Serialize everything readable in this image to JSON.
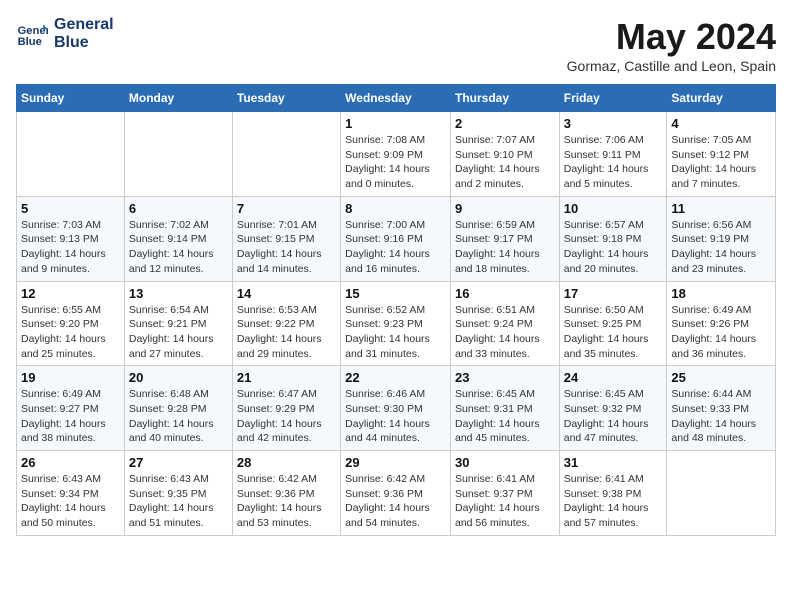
{
  "header": {
    "logo_line1": "General",
    "logo_line2": "Blue",
    "month_title": "May 2024",
    "location": "Gormaz, Castille and Leon, Spain"
  },
  "weekdays": [
    "Sunday",
    "Monday",
    "Tuesday",
    "Wednesday",
    "Thursday",
    "Friday",
    "Saturday"
  ],
  "weeks": [
    [
      {
        "day": "",
        "sunrise": "",
        "sunset": "",
        "daylight": ""
      },
      {
        "day": "",
        "sunrise": "",
        "sunset": "",
        "daylight": ""
      },
      {
        "day": "",
        "sunrise": "",
        "sunset": "",
        "daylight": ""
      },
      {
        "day": "1",
        "sunrise": "Sunrise: 7:08 AM",
        "sunset": "Sunset: 9:09 PM",
        "daylight": "Daylight: 14 hours and 0 minutes."
      },
      {
        "day": "2",
        "sunrise": "Sunrise: 7:07 AM",
        "sunset": "Sunset: 9:10 PM",
        "daylight": "Daylight: 14 hours and 2 minutes."
      },
      {
        "day": "3",
        "sunrise": "Sunrise: 7:06 AM",
        "sunset": "Sunset: 9:11 PM",
        "daylight": "Daylight: 14 hours and 5 minutes."
      },
      {
        "day": "4",
        "sunrise": "Sunrise: 7:05 AM",
        "sunset": "Sunset: 9:12 PM",
        "daylight": "Daylight: 14 hours and 7 minutes."
      }
    ],
    [
      {
        "day": "5",
        "sunrise": "Sunrise: 7:03 AM",
        "sunset": "Sunset: 9:13 PM",
        "daylight": "Daylight: 14 hours and 9 minutes."
      },
      {
        "day": "6",
        "sunrise": "Sunrise: 7:02 AM",
        "sunset": "Sunset: 9:14 PM",
        "daylight": "Daylight: 14 hours and 12 minutes."
      },
      {
        "day": "7",
        "sunrise": "Sunrise: 7:01 AM",
        "sunset": "Sunset: 9:15 PM",
        "daylight": "Daylight: 14 hours and 14 minutes."
      },
      {
        "day": "8",
        "sunrise": "Sunrise: 7:00 AM",
        "sunset": "Sunset: 9:16 PM",
        "daylight": "Daylight: 14 hours and 16 minutes."
      },
      {
        "day": "9",
        "sunrise": "Sunrise: 6:59 AM",
        "sunset": "Sunset: 9:17 PM",
        "daylight": "Daylight: 14 hours and 18 minutes."
      },
      {
        "day": "10",
        "sunrise": "Sunrise: 6:57 AM",
        "sunset": "Sunset: 9:18 PM",
        "daylight": "Daylight: 14 hours and 20 minutes."
      },
      {
        "day": "11",
        "sunrise": "Sunrise: 6:56 AM",
        "sunset": "Sunset: 9:19 PM",
        "daylight": "Daylight: 14 hours and 23 minutes."
      }
    ],
    [
      {
        "day": "12",
        "sunrise": "Sunrise: 6:55 AM",
        "sunset": "Sunset: 9:20 PM",
        "daylight": "Daylight: 14 hours and 25 minutes."
      },
      {
        "day": "13",
        "sunrise": "Sunrise: 6:54 AM",
        "sunset": "Sunset: 9:21 PM",
        "daylight": "Daylight: 14 hours and 27 minutes."
      },
      {
        "day": "14",
        "sunrise": "Sunrise: 6:53 AM",
        "sunset": "Sunset: 9:22 PM",
        "daylight": "Daylight: 14 hours and 29 minutes."
      },
      {
        "day": "15",
        "sunrise": "Sunrise: 6:52 AM",
        "sunset": "Sunset: 9:23 PM",
        "daylight": "Daylight: 14 hours and 31 minutes."
      },
      {
        "day": "16",
        "sunrise": "Sunrise: 6:51 AM",
        "sunset": "Sunset: 9:24 PM",
        "daylight": "Daylight: 14 hours and 33 minutes."
      },
      {
        "day": "17",
        "sunrise": "Sunrise: 6:50 AM",
        "sunset": "Sunset: 9:25 PM",
        "daylight": "Daylight: 14 hours and 35 minutes."
      },
      {
        "day": "18",
        "sunrise": "Sunrise: 6:49 AM",
        "sunset": "Sunset: 9:26 PM",
        "daylight": "Daylight: 14 hours and 36 minutes."
      }
    ],
    [
      {
        "day": "19",
        "sunrise": "Sunrise: 6:49 AM",
        "sunset": "Sunset: 9:27 PM",
        "daylight": "Daylight: 14 hours and 38 minutes."
      },
      {
        "day": "20",
        "sunrise": "Sunrise: 6:48 AM",
        "sunset": "Sunset: 9:28 PM",
        "daylight": "Daylight: 14 hours and 40 minutes."
      },
      {
        "day": "21",
        "sunrise": "Sunrise: 6:47 AM",
        "sunset": "Sunset: 9:29 PM",
        "daylight": "Daylight: 14 hours and 42 minutes."
      },
      {
        "day": "22",
        "sunrise": "Sunrise: 6:46 AM",
        "sunset": "Sunset: 9:30 PM",
        "daylight": "Daylight: 14 hours and 44 minutes."
      },
      {
        "day": "23",
        "sunrise": "Sunrise: 6:45 AM",
        "sunset": "Sunset: 9:31 PM",
        "daylight": "Daylight: 14 hours and 45 minutes."
      },
      {
        "day": "24",
        "sunrise": "Sunrise: 6:45 AM",
        "sunset": "Sunset: 9:32 PM",
        "daylight": "Daylight: 14 hours and 47 minutes."
      },
      {
        "day": "25",
        "sunrise": "Sunrise: 6:44 AM",
        "sunset": "Sunset: 9:33 PM",
        "daylight": "Daylight: 14 hours and 48 minutes."
      }
    ],
    [
      {
        "day": "26",
        "sunrise": "Sunrise: 6:43 AM",
        "sunset": "Sunset: 9:34 PM",
        "daylight": "Daylight: 14 hours and 50 minutes."
      },
      {
        "day": "27",
        "sunrise": "Sunrise: 6:43 AM",
        "sunset": "Sunset: 9:35 PM",
        "daylight": "Daylight: 14 hours and 51 minutes."
      },
      {
        "day": "28",
        "sunrise": "Sunrise: 6:42 AM",
        "sunset": "Sunset: 9:36 PM",
        "daylight": "Daylight: 14 hours and 53 minutes."
      },
      {
        "day": "29",
        "sunrise": "Sunrise: 6:42 AM",
        "sunset": "Sunset: 9:36 PM",
        "daylight": "Daylight: 14 hours and 54 minutes."
      },
      {
        "day": "30",
        "sunrise": "Sunrise: 6:41 AM",
        "sunset": "Sunset: 9:37 PM",
        "daylight": "Daylight: 14 hours and 56 minutes."
      },
      {
        "day": "31",
        "sunrise": "Sunrise: 6:41 AM",
        "sunset": "Sunset: 9:38 PM",
        "daylight": "Daylight: 14 hours and 57 minutes."
      },
      {
        "day": "",
        "sunrise": "",
        "sunset": "",
        "daylight": ""
      }
    ]
  ]
}
